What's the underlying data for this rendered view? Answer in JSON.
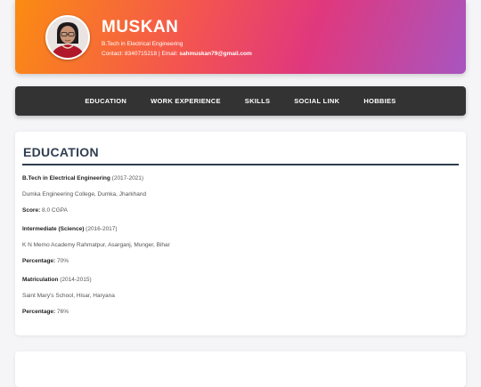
{
  "header": {
    "name": "MUSKAN",
    "degree": "B.Tech in Electrical Engineering",
    "contact_prefix": "Contact: 8340715218 | Email: ",
    "email": "sahmuskan79@gmail.com"
  },
  "nav": {
    "items": [
      {
        "label": "EDUCATION"
      },
      {
        "label": "WORK EXPERIENCE"
      },
      {
        "label": "SKILLS"
      },
      {
        "label": "SOCIAL LINK"
      },
      {
        "label": "HOBBIES"
      }
    ]
  },
  "education": {
    "title": "EDUCATION",
    "entries": [
      {
        "degree": "B.Tech in Electrical Engineering",
        "years": " (2017-2021)",
        "institution": "Dumka Engineering College, Dumka, Jharkhand",
        "score_label": "Score:",
        "score_value": " 8.0 CGPA"
      },
      {
        "degree": "Intermediate (Science)",
        "years": " (2016-2017)",
        "institution": "K N Memo Academy Rahmatpur, Asarganj, Munger, Bihar",
        "score_label": "Percentage:",
        "score_value": " 70%"
      },
      {
        "degree": "Matriculation",
        "years": " (2014-2015)",
        "institution": "Saint Mary's School, Hisar, Haryana",
        "score_label": "Percentage:",
        "score_value": " 76%"
      }
    ]
  },
  "colors": {
    "header_gradient_start": "#fb8c12",
    "header_gradient_end": "#a855c0",
    "nav_background": "#333333",
    "heading_color": "#2f3e50"
  }
}
